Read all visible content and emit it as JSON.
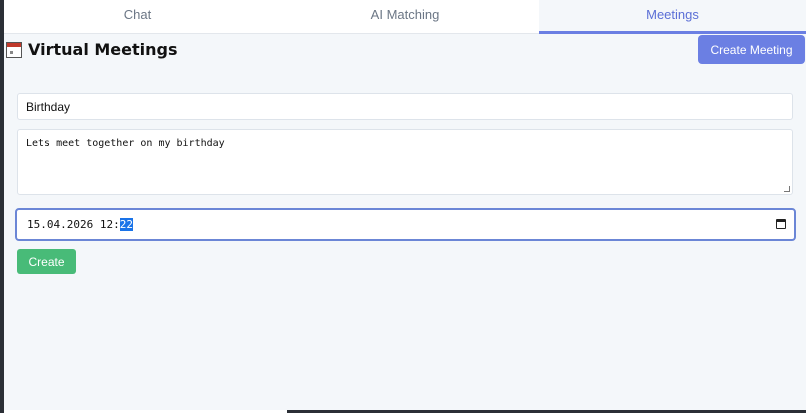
{
  "tabs": [
    {
      "label": "Chat"
    },
    {
      "label": "AI Matching"
    },
    {
      "label": "Meetings"
    }
  ],
  "active_tab": "Meetings",
  "header": {
    "icon": "calendar-icon",
    "title": "Virtual Meetings",
    "create_meeting_label": "Create Meeting"
  },
  "form": {
    "name_value": "Birthday",
    "description_value": "Lets meet together on my birthday",
    "datetime": {
      "prefix": "15.04.2026 12:",
      "selected_minutes": "22"
    },
    "submit_label": "Create"
  },
  "colors": {
    "accent": "#6b7fe3",
    "success": "#48bb78",
    "background": "#f4f7fa"
  }
}
